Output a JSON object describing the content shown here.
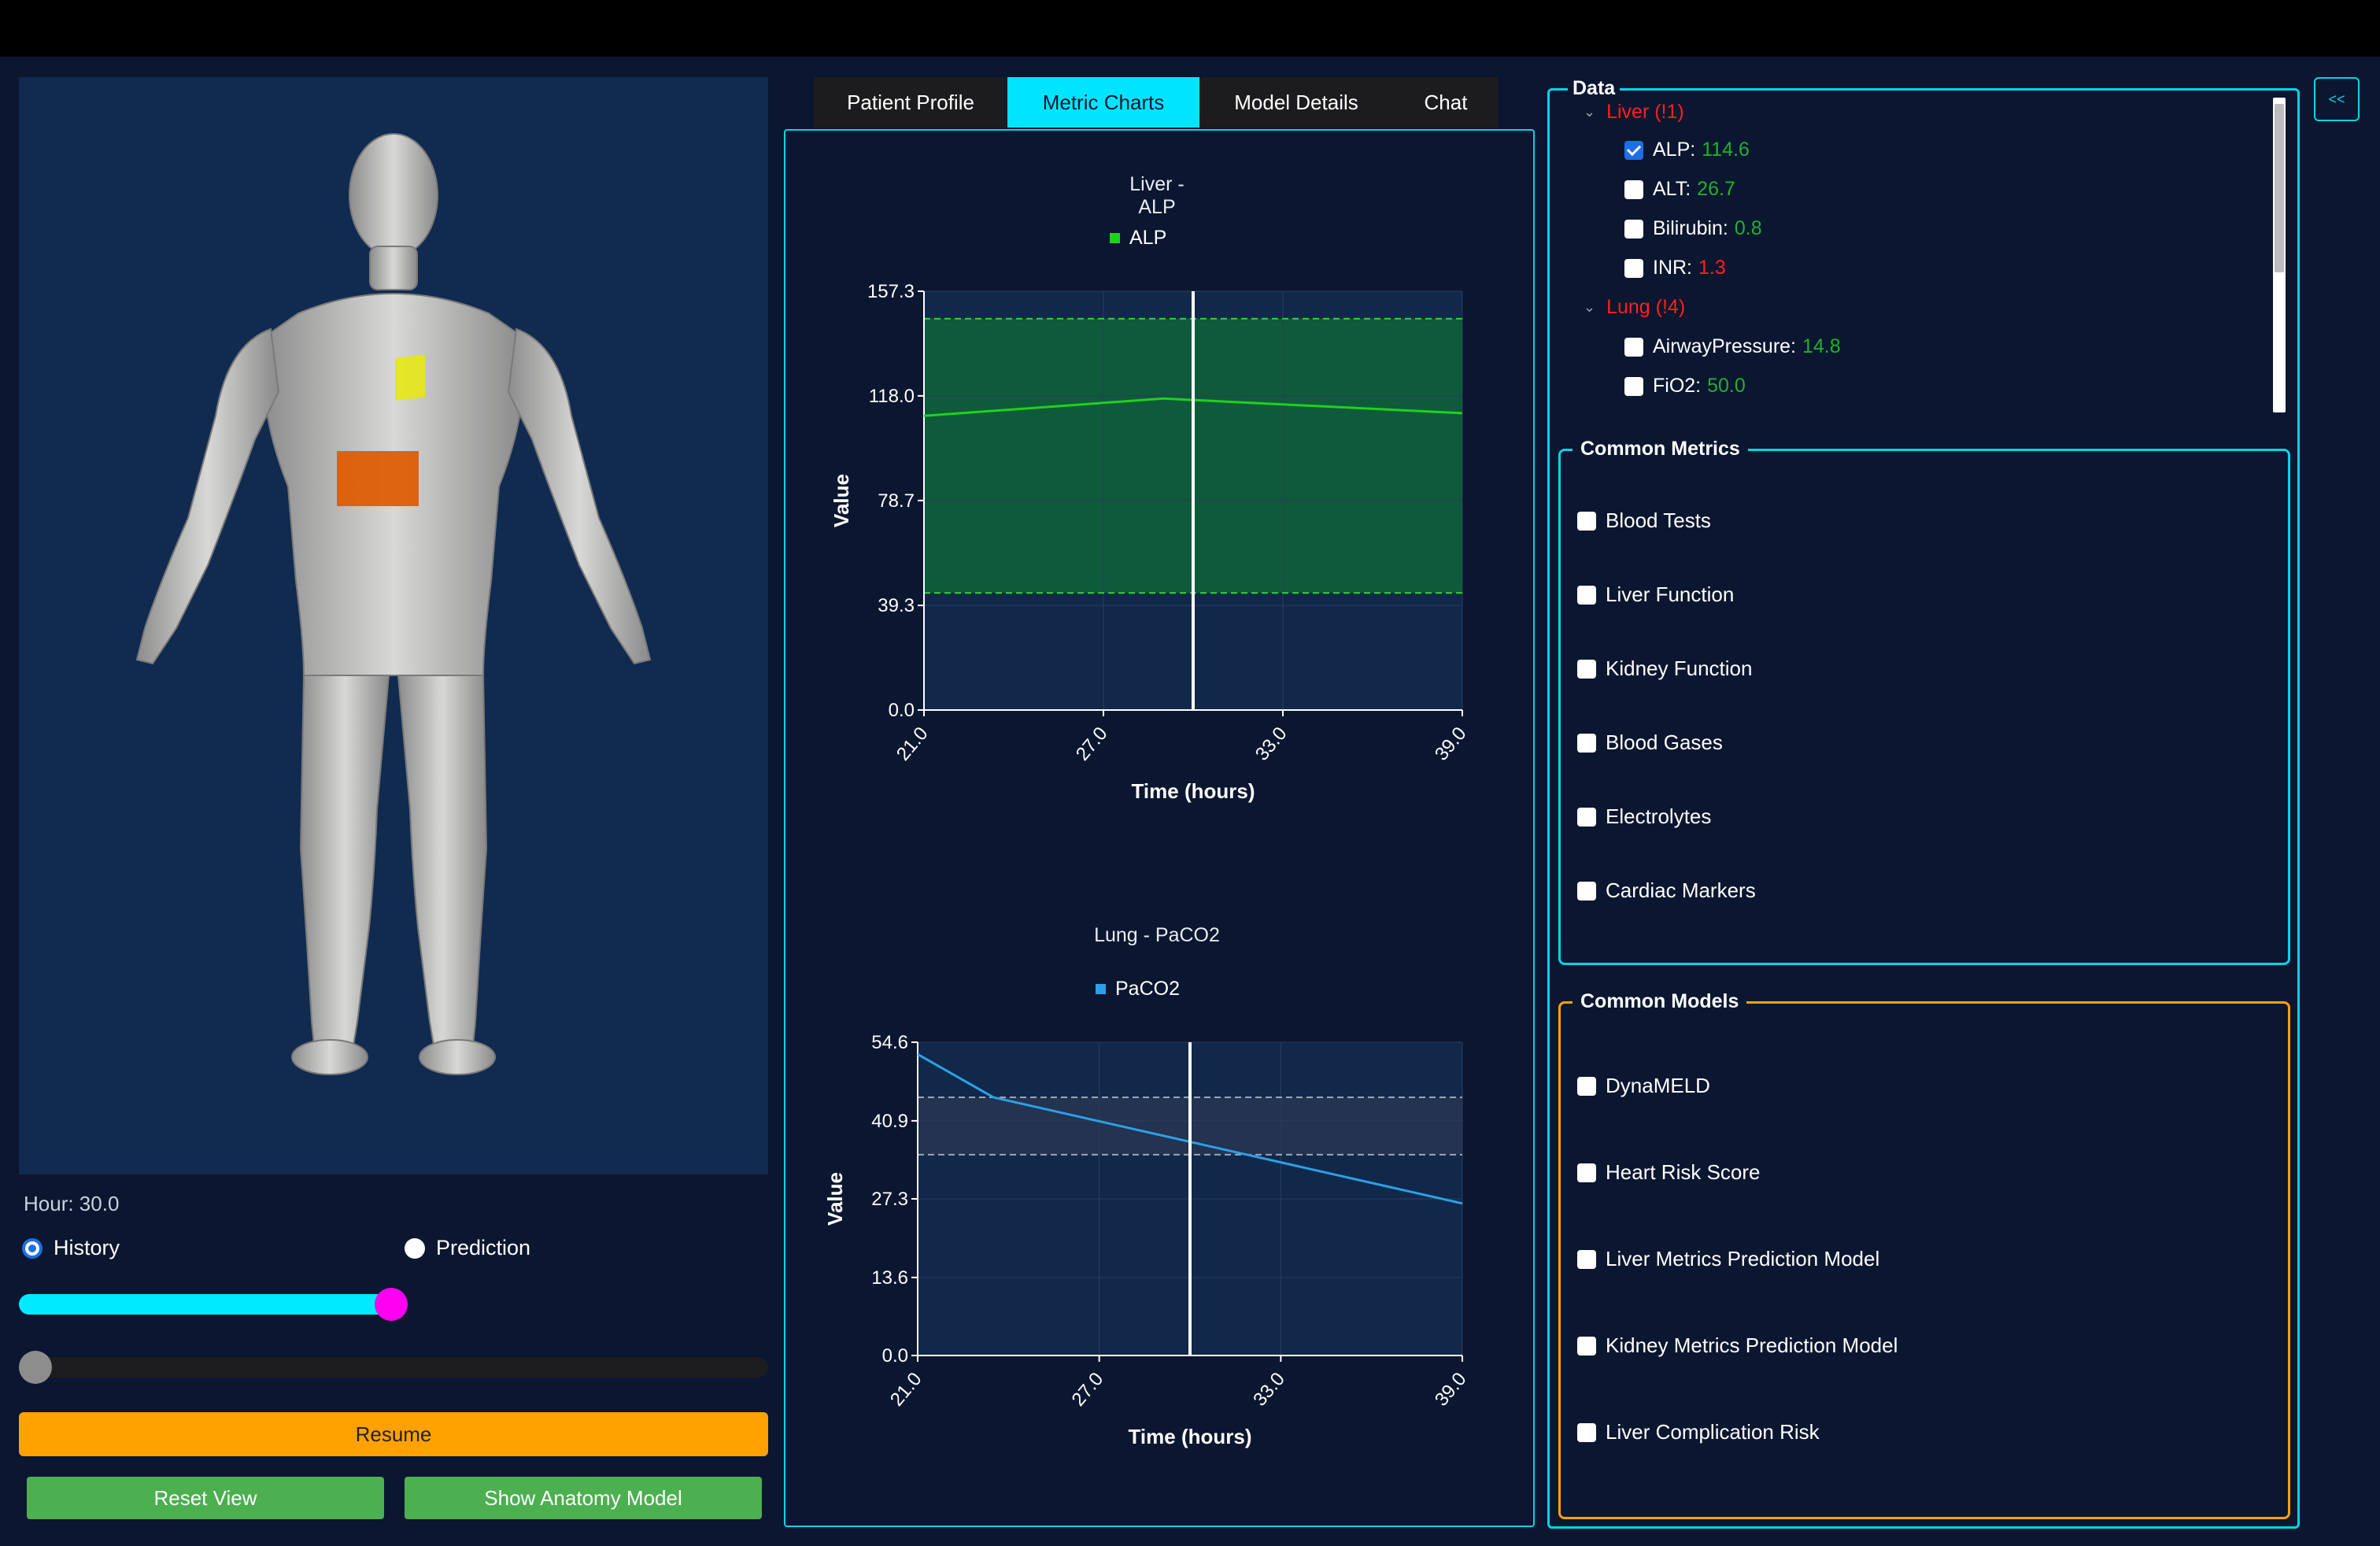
{
  "viewer": {
    "hour_label": "Hour: 30.0",
    "mode_history": "History",
    "mode_prediction": "Prediction",
    "selected_mode": "History",
    "timeline_progress": 0.5,
    "scrub_progress": 0.0,
    "resume_label": "Resume",
    "reset_view_label": "Reset View",
    "show_anatomy_label": "Show Anatomy Model",
    "colors": {
      "resume": "#ffa200",
      "green_buttons": "#4caf50",
      "slider": "#00eaff",
      "slider_thumb": "#ff00f0"
    }
  },
  "tabs": [
    {
      "label": "Patient Profile",
      "active": false
    },
    {
      "label": "Metric Charts",
      "active": true
    },
    {
      "label": "Model Details",
      "active": false
    },
    {
      "label": "Chat",
      "active": false
    }
  ],
  "chart_data": [
    {
      "type": "line",
      "title": "Liver - ALP",
      "legend": "ALP",
      "color": "#1ed11e",
      "x": [
        21.0,
        29.0,
        39.0
      ],
      "y": [
        110.5,
        117.0,
        111.5
      ],
      "xlabel": "Time (hours)",
      "ylabel": "Value",
      "xlim": [
        21.0,
        39.0
      ],
      "ylim": [
        0.0,
        157.3
      ],
      "xticks": [
        "21.0",
        "27.0",
        "33.0",
        "39.0"
      ],
      "yticks": [
        "0.0",
        "39.3",
        "78.7",
        "118.0",
        "157.3"
      ],
      "normal_range": [
        44.0,
        147.0
      ],
      "current_time": 30.0,
      "colors": {
        "band": "#0f5a3a"
      }
    },
    {
      "type": "line",
      "title": "Lung - PaCO2",
      "legend": "PaCO2",
      "color": "#2aa1e6",
      "x": [
        21.0,
        23.5,
        39.0
      ],
      "y": [
        52.5,
        45.0,
        26.5
      ],
      "xlabel": "Time (hours)",
      "ylabel": "Value",
      "xlim": [
        21.0,
        39.0
      ],
      "ylim": [
        0.0,
        54.6
      ],
      "xticks": [
        "21.0",
        "27.0",
        "33.0",
        "39.0"
      ],
      "yticks": [
        "0.0",
        "13.6",
        "27.3",
        "40.9",
        "54.6"
      ],
      "normal_range": [
        35.0,
        45.0
      ],
      "current_time": 30.0,
      "colors": {
        "band": "#233350"
      }
    }
  ],
  "data_panel": {
    "title": "Data",
    "groups": [
      {
        "label": "Liver (!1)",
        "items": [
          {
            "name": "ALP:",
            "value": "114.6",
            "status": "normal",
            "checked": true
          },
          {
            "name": "ALT:",
            "value": "26.7",
            "status": "normal",
            "checked": false
          },
          {
            "name": "Bilirubin:",
            "value": "0.8",
            "status": "normal",
            "checked": false
          },
          {
            "name": "INR:",
            "value": "1.3",
            "status": "abnormal",
            "checked": false
          }
        ]
      },
      {
        "label": "Lung (!4)",
        "items": [
          {
            "name": "AirwayPressure:",
            "value": "14.8",
            "status": "normal",
            "checked": false
          },
          {
            "name": "FiO2:",
            "value": "50.0",
            "status": "normal",
            "checked": false
          }
        ]
      }
    ]
  },
  "common_metrics": {
    "title": "Common Metrics",
    "items": [
      "Blood Tests",
      "Liver Function",
      "Kidney Function",
      "Blood Gases",
      "Electrolytes",
      "Cardiac Markers"
    ]
  },
  "common_models": {
    "title": "Common Models",
    "items": [
      "DynaMELD",
      "Heart Risk Score",
      "Liver Metrics Prediction Model",
      "Kidney Metrics Prediction Model",
      "Liver Complication Risk"
    ]
  },
  "collapse_button_icon": "chevron-double-left-icon",
  "collapse_button_glyph": "<<"
}
